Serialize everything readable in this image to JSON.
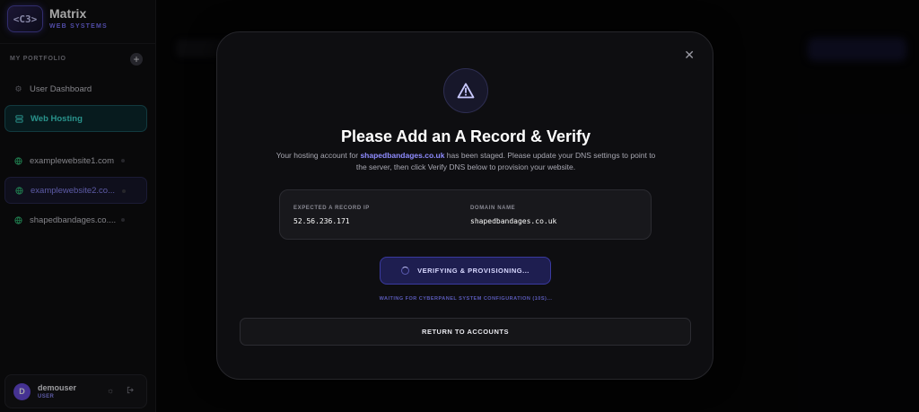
{
  "brand": {
    "logo_text": "<C3>",
    "title": "Matrix",
    "subtitle": "WEB SYSTEMS"
  },
  "sidebar": {
    "section_label": "MY PORTFOLIO",
    "add_label": "+",
    "items": [
      {
        "label": "User Dashboard",
        "icon": "gear-icon"
      },
      {
        "label": "Web Hosting",
        "icon": "server-icon"
      }
    ],
    "sites": [
      {
        "label": "examplewebsite1.com",
        "icon": "globe-icon"
      },
      {
        "label": "examplewebsite2.co...",
        "icon": "globe-icon"
      },
      {
        "label": "shapedbandages.co....",
        "icon": "globe-icon"
      }
    ]
  },
  "user": {
    "initial": "D",
    "name": "demouser",
    "role": "USER"
  },
  "modal": {
    "title": "Please Add an A Record & Verify",
    "desc_prefix": "Your hosting account for ",
    "desc_domain": "shapedbandages.co.uk",
    "desc_suffix": " has been staged. Please update your DNS settings to point to the server, then click Verify DNS below to provision your website.",
    "ip_label": "EXPECTED A RECORD IP",
    "ip_value": "52.56.236.171",
    "domain_label": "DOMAIN NAME",
    "domain_value": "shapedbandages.co.uk",
    "verify_label": "VERIFYING & PROVISIONING...",
    "waiting_text": "WAITING FOR CYBERPANEL SYSTEM CONFIGURATION (10S)...",
    "return_label": "RETURN TO ACCOUNTS",
    "close_symbol": "✕"
  },
  "colors": {
    "accent": "#8f8cff",
    "hosting": "#3fe0d6",
    "site_icon": "#32c27a"
  }
}
